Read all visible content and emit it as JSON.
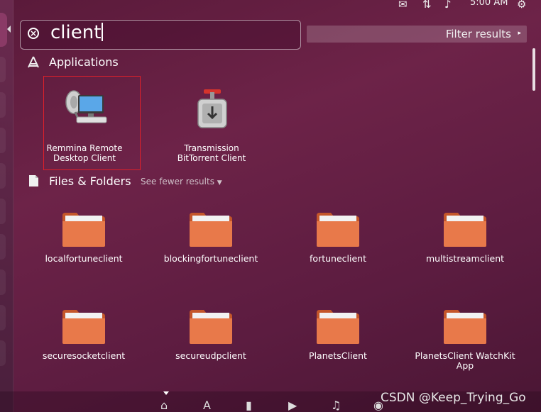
{
  "top_panel": {
    "icons": [
      "messaging-icon",
      "network-icon",
      "volume-icon",
      "settings-gear-icon"
    ],
    "time": "5:00 AM"
  },
  "search": {
    "query": "client"
  },
  "filter": {
    "label": "Filter results",
    "arrow": "▸"
  },
  "applications": {
    "title": "Applications",
    "items": [
      {
        "label": "Remmina Remote\nDesktop Client",
        "icon": "remmina-icon",
        "highlighted": true
      },
      {
        "label": "Transmission\nBitTorrent Client",
        "icon": "transmission-icon",
        "highlighted": false
      }
    ]
  },
  "files": {
    "title": "Files & Folders",
    "see_fewer": "See fewer results",
    "items": [
      {
        "label": "localfortuneclient"
      },
      {
        "label": "blockingfortuneclient"
      },
      {
        "label": "fortuneclient"
      },
      {
        "label": "multistreamclient"
      },
      {
        "label": "securesocketclient"
      },
      {
        "label": "secureudpclient"
      },
      {
        "label": "PlanetsClient"
      },
      {
        "label": "PlanetsClient WatchKit\nApp"
      }
    ]
  },
  "dock": {
    "lenses": [
      "home-lens-icon",
      "applications-lens-icon",
      "files-lens-icon",
      "video-lens-icon",
      "music-lens-icon",
      "photo-lens-icon"
    ]
  },
  "watermark": "CSDN @Keep_Trying_Go",
  "colors": {
    "highlight": "#e0202a",
    "folder": "#e8794a"
  }
}
